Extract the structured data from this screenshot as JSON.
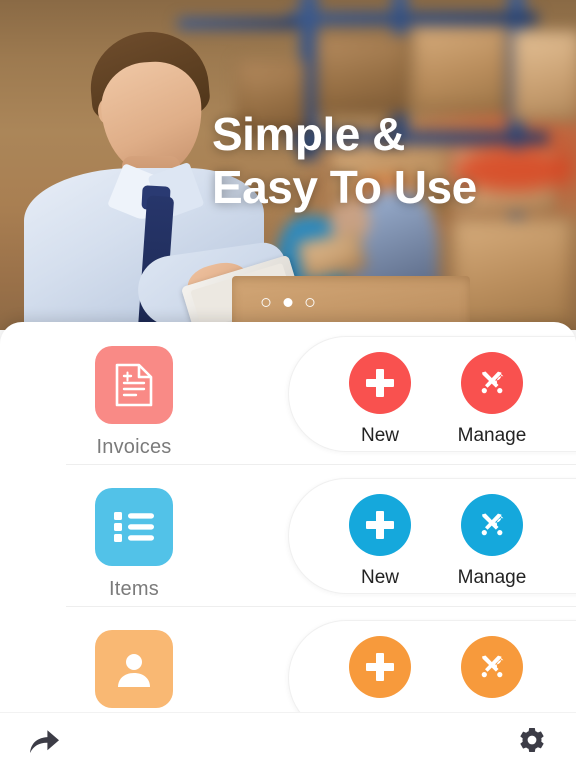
{
  "hero": {
    "headline_line1": "Simple &",
    "headline_line2": "Easy To Use",
    "pager": {
      "total": 3,
      "active_index": 1
    }
  },
  "panel": {
    "rows": [
      {
        "id": "invoices",
        "label": "Invoices",
        "tile_color": "#F98A86",
        "accent_color": "#F9514F",
        "icon": "invoice-document-icon",
        "actions": [
          {
            "label": "New",
            "icon": "plus-icon"
          },
          {
            "label": "Manage",
            "icon": "tools-icon"
          }
        ]
      },
      {
        "id": "items",
        "label": "Items",
        "tile_color": "#52C2E8",
        "accent_color": "#15A8DC",
        "icon": "bulleted-list-icon",
        "actions": [
          {
            "label": "New",
            "icon": "plus-icon"
          },
          {
            "label": "Manage",
            "icon": "tools-icon"
          }
        ]
      },
      {
        "id": "customers",
        "label": "",
        "tile_color": "#F9B873",
        "accent_color": "#F79A3C",
        "icon": "person-icon",
        "actions": [
          {
            "label": "",
            "icon": "plus-icon"
          },
          {
            "label": "",
            "icon": "tools-icon"
          }
        ]
      }
    ]
  },
  "bottombar": {
    "share": {
      "icon": "share-arrow-icon"
    },
    "settings": {
      "icon": "gear-icon"
    }
  }
}
